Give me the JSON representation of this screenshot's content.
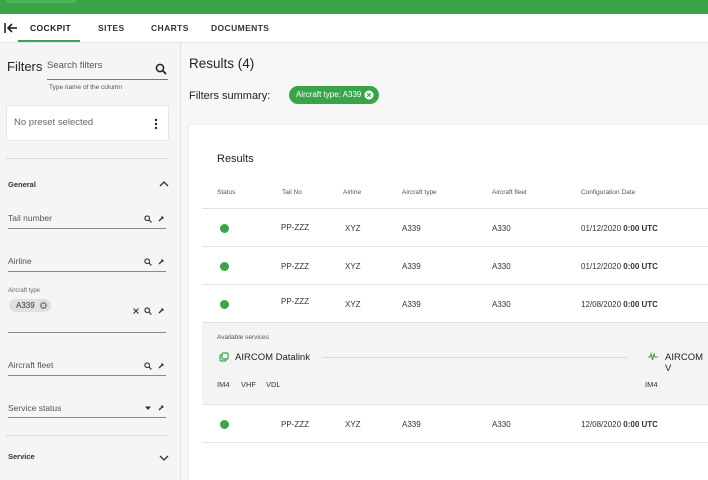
{
  "tabs": [
    "COCKPIT",
    "SITES",
    "CHARTS",
    "DOCUMENTS"
  ],
  "colors": {
    "accent": "#3aa547",
    "status_ok": "#3aa547"
  },
  "sidebar": {
    "title": "Filters",
    "search_placeholder": "Search filters",
    "search_hint": "Type name of the column",
    "preset": "No preset selected",
    "sections": {
      "general": "General",
      "service": "Service"
    },
    "fields": {
      "tail_number": "Tail number",
      "airline": "Airline",
      "aircraft_type_label": "Aircraft type",
      "aircraft_type_chip": "A339",
      "aircraft_fleet": "Aircraft fleet",
      "service_status": "Service status"
    }
  },
  "main": {
    "results_title": "Results (4)",
    "summary_label": "Filters summary:",
    "summary_chip": "Aircraft type: A339",
    "card_title": "Results",
    "columns": [
      "Status",
      "Tail No",
      "Airline",
      "Aircraft type",
      "Aircraft fleet",
      "Configuration Date"
    ],
    "rows": [
      {
        "tail": "PP-ZZZ",
        "airline": "XYZ",
        "type": "A339",
        "fleet": "A330",
        "date": "01/12/2020",
        "time": "0:00 UTC"
      },
      {
        "tail": "PP-ZZZ",
        "airline": "XYZ",
        "type": "A339",
        "fleet": "A330",
        "date": "01/12/2020",
        "time": "0:00 UTC"
      },
      {
        "tail": "PP-ZZZ",
        "airline": "XYZ",
        "type": "A339",
        "fleet": "A330",
        "date": "12/08/2020",
        "time": "0:00 UTC"
      },
      {
        "tail": "PP-ZZZ",
        "airline": "XYZ",
        "type": "A339",
        "fleet": "A330",
        "date": "12/08/2020",
        "time": "0:00 UTC"
      }
    ],
    "expanded": {
      "available_label": "Available services",
      "service1": {
        "name": "AIRCOM Datalink",
        "subs": [
          "IM4",
          "VHF",
          "VDL"
        ]
      },
      "service2": {
        "name": "AIRCOM V",
        "subs": [
          "IM4"
        ]
      }
    }
  }
}
